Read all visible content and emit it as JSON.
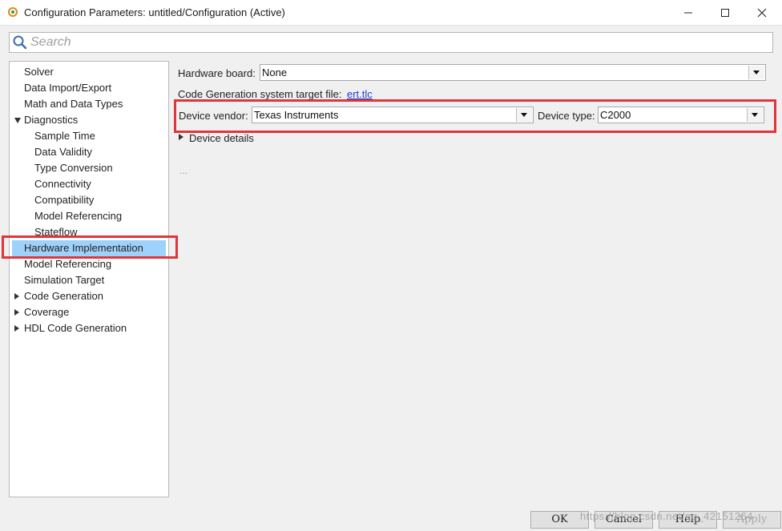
{
  "window": {
    "title": "Configuration Parameters: untitled/Configuration (Active)"
  },
  "search": {
    "placeholder": "Search",
    "value": ""
  },
  "tree": {
    "items": [
      {
        "label": "Solver"
      },
      {
        "label": "Data Import/Export"
      },
      {
        "label": "Math and Data Types"
      },
      {
        "label": "Diagnostics",
        "expanded": true
      },
      {
        "label": "Sample Time"
      },
      {
        "label": "Data Validity"
      },
      {
        "label": "Type Conversion"
      },
      {
        "label": "Connectivity"
      },
      {
        "label": "Compatibility"
      },
      {
        "label": "Model Referencing"
      },
      {
        "label": "Stateflow"
      },
      {
        "label": "Hardware Implementation",
        "selected": true
      },
      {
        "label": "Model Referencing"
      },
      {
        "label": "Simulation Target"
      },
      {
        "label": "Code Generation",
        "expanded": false
      },
      {
        "label": "Coverage",
        "expanded": false
      },
      {
        "label": "HDL Code Generation",
        "expanded": false
      }
    ]
  },
  "main": {
    "hardware_board_label": "Hardware board:",
    "hardware_board_value": "None",
    "codegen_target_label": "Code Generation system target file:",
    "codegen_target_link": "ert.tlc",
    "device_vendor_label": "Device vendor:",
    "device_vendor_value": "Texas Instruments",
    "device_type_label": "Device type:",
    "device_type_value": "C2000",
    "device_details_label": "Device details",
    "ellipsis": "..."
  },
  "buttons": {
    "ok": "OK",
    "cancel": "Cancel",
    "help": "Help",
    "apply": "Apply"
  },
  "watermark": "https://blog.csdn.net/qq_42151264",
  "colors": {
    "highlight": "#e0353b",
    "selection": "#9fd2fb",
    "link": "#1a3fd6"
  }
}
